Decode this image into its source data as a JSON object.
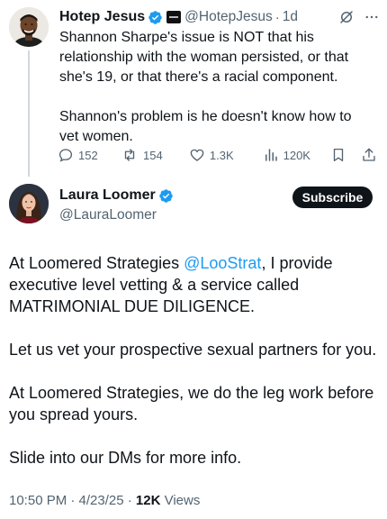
{
  "parent_tweet": {
    "author_name": "Hotep Jesus",
    "handle": "@HotepJesus",
    "separator": "·",
    "time": "1d",
    "text": "Shannon Sharpe's issue is NOT that his relationship with the woman persisted, or that she's 19, or that there's a racial component.\n\nShannon's problem is he doesn't know how to vet women.",
    "icons": [
      "avatar",
      "verified-badge-icon",
      "affiliate-badge-icon",
      "grok-icon",
      "more-icon"
    ],
    "actions": {
      "replies": "152",
      "reposts": "154",
      "likes": "1.3K",
      "views": "120K"
    },
    "action_icons": [
      "reply-icon",
      "repost-icon",
      "like-icon",
      "views-icon",
      "bookmark-icon",
      "share-icon"
    ]
  },
  "main_tweet": {
    "author_name": "Laura Loomer",
    "handle": "@LauraLoomer",
    "subscribe_label": "Subscribe",
    "paragraphs": {
      "p1_before": "At Loomered Strategies ",
      "p1_mention": "@LooStrat",
      "p1_after": ", I provide executive level vetting & a service called MATRIMONIAL DUE DILIGENCE.",
      "p2": "Let us vet your prospective sexual partners for you.",
      "p3": "At Loomered Strategies, we do the leg work before you spread yours.",
      "p4": "Slide into our DMs for more info."
    },
    "timestamp": "10:50 PM · 4/23/25 · ",
    "views_count": "12K",
    "views_label": " Views"
  },
  "colors": {
    "text": "#0f1419",
    "secondary": "#536471",
    "accent": "#1d9bf0",
    "thread_line": "#cfd9de"
  }
}
